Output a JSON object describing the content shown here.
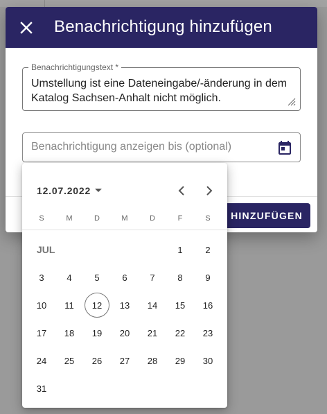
{
  "dialog": {
    "title": "Benachrichtigung hinzufügen",
    "close_icon": "close-icon",
    "text_field": {
      "label": "Benachrichtigungstext *",
      "value": "Umstellung ist eine Dateneingabe/-änderung in dem Katalog Sachsen-Anhalt nicht möglich."
    },
    "date_field": {
      "placeholder": "Benachrichtigung anzeigen bis (optional)",
      "icon": "calendar-icon"
    },
    "add_button_label": "HINZUFÜGEN"
  },
  "datepicker": {
    "selected_label": "12.07.2022",
    "month_abbr": "JUL",
    "weekdays": [
      "S",
      "M",
      "D",
      "M",
      "D",
      "F",
      "S"
    ],
    "first_weekday_index": 5,
    "days_in_month": 31,
    "today": 12,
    "days": [
      "1",
      "2",
      "3",
      "4",
      "5",
      "6",
      "7",
      "8",
      "9",
      "10",
      "11",
      "12",
      "13",
      "14",
      "15",
      "16",
      "17",
      "18",
      "19",
      "20",
      "21",
      "22",
      "23",
      "24",
      "25",
      "26",
      "27",
      "28",
      "29",
      "30",
      "31"
    ]
  },
  "colors": {
    "primary": "#2a2563",
    "backdrop": "#9a9a9a"
  }
}
